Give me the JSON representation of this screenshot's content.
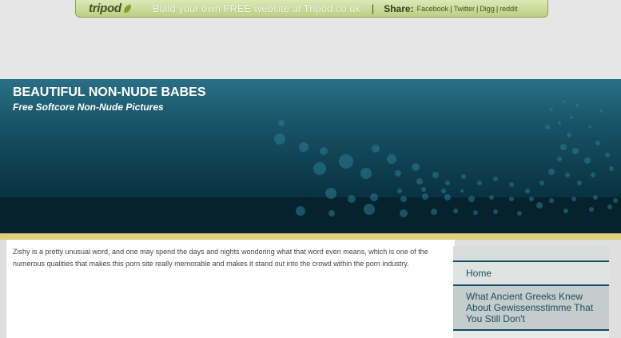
{
  "tripod": {
    "logo": "tripod",
    "promo": "Build your own FREE website at Tripod.co.uk",
    "separator": "|",
    "share_label": "Share:",
    "share_links": [
      "Facebook",
      "Twitter",
      "Digg",
      "reddit"
    ]
  },
  "header": {
    "title": "BEAUTIFUL NON-NUDE BABES",
    "subtitle": "Free Softcore Non-Nude Pictures"
  },
  "main": {
    "paragraph": "Zishy is a pretty unusual word, and one may spend the days and nights wondering what that word even means, which is one of the numerous qualities that makes this porn site really memorable and makes it stand out into the crowd within the porn industry."
  },
  "sidebar": {
    "items": [
      {
        "label": "Home"
      },
      {
        "label": "What Ancient Greeks Knew About Gewissensstimme That You Still Don't"
      }
    ]
  },
  "colors": {
    "tripod_bar": "#c8d89a",
    "banner": "#0e3e4f",
    "accent_rule": "#dccf7e",
    "sidebar_link": "#1c4d5c"
  }
}
